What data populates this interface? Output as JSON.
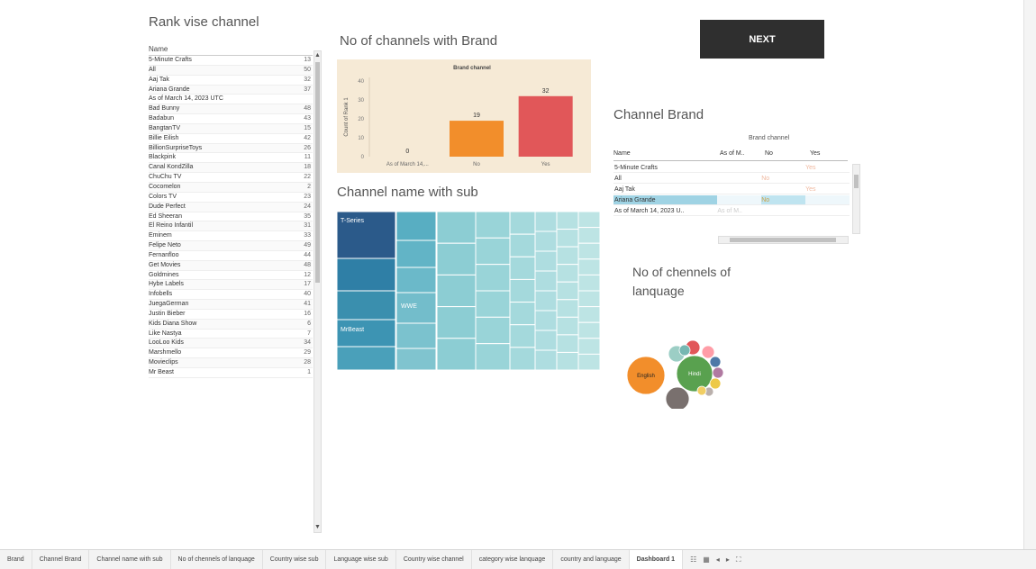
{
  "rank": {
    "title": "Rank vise channel",
    "column_header": "Name",
    "rows": [
      {
        "name": "5-Minute Crafts",
        "value": "13"
      },
      {
        "name": "All",
        "value": "50"
      },
      {
        "name": "Aaj Tak",
        "value": "32"
      },
      {
        "name": "Ariana Grande",
        "value": "37"
      },
      {
        "name": "As of March 14, 2023 UTC",
        "value": ""
      },
      {
        "name": "Bad Bunny",
        "value": "48"
      },
      {
        "name": "Badabun",
        "value": "43"
      },
      {
        "name": "BangtanTV",
        "value": "15"
      },
      {
        "name": "Billie Eilish",
        "value": "42"
      },
      {
        "name": "BillionSurpriseToys",
        "value": "26"
      },
      {
        "name": "Blackpink",
        "value": "11"
      },
      {
        "name": "Canal KondZilla",
        "value": "18"
      },
      {
        "name": "ChuChu TV",
        "value": "22"
      },
      {
        "name": "Cocomelon",
        "value": "2"
      },
      {
        "name": "Colors TV",
        "value": "23"
      },
      {
        "name": "Dude Perfect",
        "value": "24"
      },
      {
        "name": "Ed Sheeran",
        "value": "35"
      },
      {
        "name": "El Reino Infantil",
        "value": "31"
      },
      {
        "name": "Eminem",
        "value": "33"
      },
      {
        "name": "Felipe Neto",
        "value": "49"
      },
      {
        "name": "Fernanfloo",
        "value": "44"
      },
      {
        "name": "Get Movies",
        "value": "48"
      },
      {
        "name": "Goldmines",
        "value": "12"
      },
      {
        "name": "Hybe Labels",
        "value": "17"
      },
      {
        "name": "Infobells",
        "value": "40"
      },
      {
        "name": "JuegaGerman",
        "value": "41"
      },
      {
        "name": "Justin Bieber",
        "value": "16"
      },
      {
        "name": "Kids Diana Show",
        "value": "6"
      },
      {
        "name": "Like Nastya",
        "value": "7"
      },
      {
        "name": "LooLoo Kids",
        "value": "34"
      },
      {
        "name": "Marshmello",
        "value": "29"
      },
      {
        "name": "Movieclips",
        "value": "28"
      },
      {
        "name": "Mr Beast",
        "value": "1"
      }
    ]
  },
  "brand_chart": {
    "title": "No of channels with Brand"
  },
  "chart_data": {
    "type": "bar",
    "title": "Brand channel",
    "categories": [
      "As of March 14, 2023 UTC",
      "No",
      "Yes"
    ],
    "category_labels": [
      "As of March 14,...",
      "No",
      "Yes"
    ],
    "values": [
      0,
      19,
      32
    ],
    "ylabel": "Count of Rank 1",
    "xlabel": "",
    "ylim": [
      0,
      40
    ],
    "yticks": [
      "40",
      "30",
      "20",
      "10",
      "0"
    ],
    "colors": [
      "#d9d9d9",
      "#f28e2b",
      "#e15759"
    ]
  },
  "next_button": {
    "label": "NEXT"
  },
  "channel_brand": {
    "title": "Channel  Brand",
    "header": "Brand channel",
    "columns": [
      "Name",
      "As of M..",
      "No",
      "Yes"
    ],
    "rows": [
      {
        "name": "5-Minute Crafts",
        "c1": "",
        "c2": "",
        "c3": "Yes"
      },
      {
        "name": "All",
        "c1": "",
        "c2": "No",
        "c3": ""
      },
      {
        "name": "Aaj Tak",
        "c1": "",
        "c2": "",
        "c3": "Yes"
      },
      {
        "name": "Ariana Grande",
        "c1": "",
        "c2": "No",
        "c3": ""
      },
      {
        "name": "As of March 14, 2023 U..",
        "c1": "As of M..",
        "c2": "",
        "c3": ""
      }
    ]
  },
  "treemap": {
    "title": "Channel name with sub",
    "labels": [
      "T-Series",
      "MrBeast",
      "WWE"
    ]
  },
  "language": {
    "title": "No of chennels of lanquage",
    "labels": [
      "English",
      "Hindi"
    ]
  },
  "tabs": [
    "Brand",
    "Channel Brand",
    "Channel name with sub",
    "No of chennels of lanquage",
    "Country wise sub",
    "Language wise sub",
    "Country wise channel",
    "category wise lanquage",
    "country and language",
    "Dashboard 1"
  ]
}
